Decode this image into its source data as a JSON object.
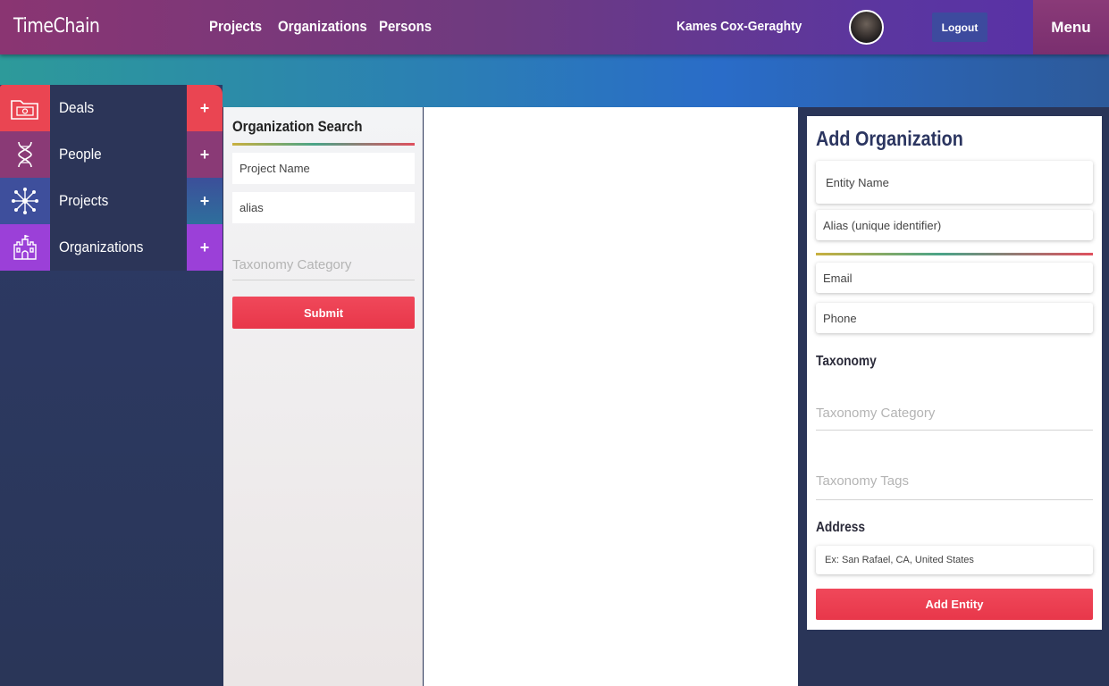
{
  "header": {
    "brand": "TimeChain",
    "nav": [
      "Projects",
      "Organizations",
      "Persons"
    ],
    "user_name": "Kames Cox-Geraghty",
    "logout_label": "Logout",
    "menu_label": "Menu"
  },
  "sidebar": {
    "items": [
      {
        "label": "Deals",
        "icon": "folder-money-icon",
        "color": "#e8404e",
        "plus": "+"
      },
      {
        "label": "People",
        "icon": "dna-icon",
        "color": "#8a3b77",
        "plus": "+"
      },
      {
        "label": "Projects",
        "icon": "network-icon",
        "color": "#3d4f9a",
        "plus": "+"
      },
      {
        "label": "Organizations",
        "icon": "castle-icon",
        "color": "#9a3fd6",
        "plus": "+"
      }
    ]
  },
  "search": {
    "title": "Organization Search",
    "project_name_placeholder": "Project Name",
    "alias_placeholder": "alias",
    "taxonomy_placeholder": "Taxonomy Category",
    "submit_label": "Submit"
  },
  "form": {
    "title": "Add Organization",
    "entity_name_placeholder": "Entity Name",
    "alias_placeholder": "Alias (unique identifier)",
    "email_placeholder": "Email",
    "phone_placeholder": "Phone",
    "taxonomy_heading": "Taxonomy",
    "taxonomy_category_placeholder": "Taxonomy Category",
    "taxonomy_tags_placeholder": "Taxonomy Tags",
    "address_heading": "Address",
    "address_placeholder": "Ex: San Rafael, CA, United States",
    "submit_label": "Add Entity"
  },
  "colors": {
    "accent_red": "#e8374a",
    "nav_purple": "#6e3a80",
    "sidebar_bg": "#2c3558",
    "logout_blue": "#3d4a9e"
  }
}
